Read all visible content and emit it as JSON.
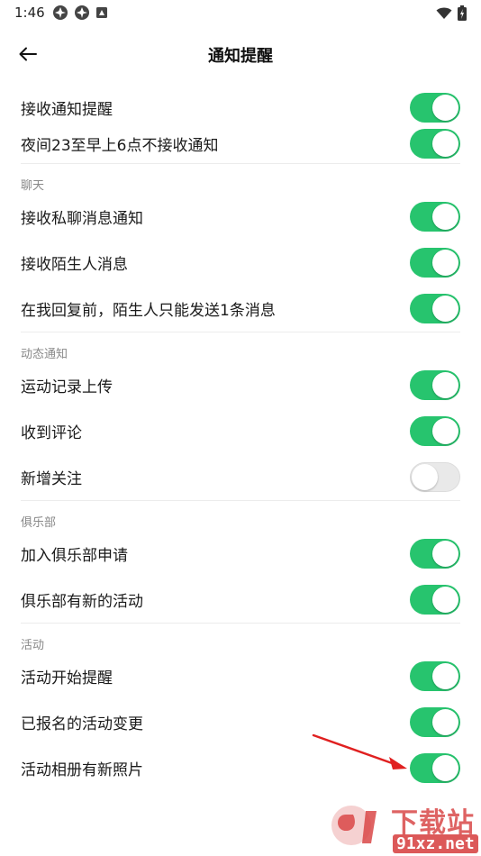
{
  "status_bar": {
    "time": "1:46"
  },
  "header": {
    "title": "通知提醒"
  },
  "rows_top": [
    {
      "label": "接收通知提醒",
      "on": true
    },
    {
      "label": "夜间23至早上6点不接收通知",
      "on": true
    }
  ],
  "sections": [
    {
      "title": "聊天",
      "items": [
        {
          "label": "接收私聊消息通知",
          "on": true
        },
        {
          "label": "接收陌生人消息",
          "on": true
        },
        {
          "label": "在我回复前，陌生人只能发送1条消息",
          "on": true
        }
      ]
    },
    {
      "title": "动态通知",
      "items": [
        {
          "label": "运动记录上传",
          "on": true
        },
        {
          "label": "收到评论",
          "on": true
        },
        {
          "label": "新增关注",
          "on": false
        }
      ]
    },
    {
      "title": "俱乐部",
      "items": [
        {
          "label": "加入俱乐部申请",
          "on": true
        },
        {
          "label": "俱乐部有新的活动",
          "on": true
        }
      ]
    },
    {
      "title": "活动",
      "items": [
        {
          "label": "活动开始提醒",
          "on": true
        },
        {
          "label": "已报名的活动变更",
          "on": true
        },
        {
          "label": "活动相册有新照片",
          "on": true
        }
      ]
    }
  ],
  "watermark": {
    "brand": "下载站",
    "domain": "91xz.net"
  },
  "colors": {
    "toggle_on": "#27c46e",
    "toggle_off": "#e9e9e9",
    "section_header": "#888888",
    "annotation_arrow": "#e02020"
  }
}
